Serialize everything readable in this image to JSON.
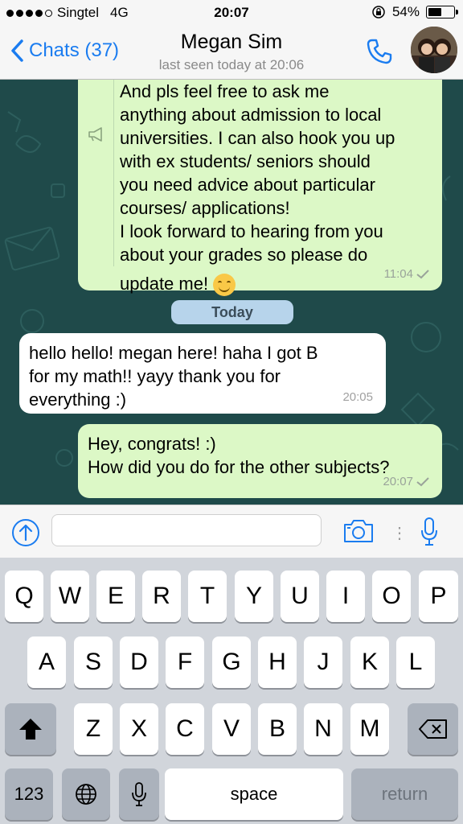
{
  "status_bar": {
    "carrier": "Singtel",
    "network": "4G",
    "time": "20:07",
    "battery_text": "54%",
    "battery_level": 0.54,
    "signal_bars": 4,
    "signal_total": 5
  },
  "nav": {
    "back_label": "Chats (37)",
    "contact_name": "Megan Sim",
    "last_seen": "last seen today at 20:06"
  },
  "messages": [
    {
      "direction": "out",
      "lines": [
        "And pls feel free to ask me",
        "anything about admission to local",
        "universities. I can also hook you up",
        "with ex students/ seniors should",
        "you need advice about particular",
        "courses/ applications!",
        "I look forward to hearing from you",
        "about your grades so please do",
        "update me!"
      ],
      "time": "11:04"
    },
    {
      "direction": "in",
      "lines": [
        "hello hello! megan here! haha I got B",
        "for my math!! yayy thank you for",
        "everything :)"
      ],
      "time": "20:05"
    },
    {
      "direction": "out",
      "lines": [
        "Hey, congrats! :)",
        "How did you do for the other subjects?"
      ],
      "time": "20:07"
    }
  ],
  "date_divider": "Today",
  "composer": {
    "value": ""
  },
  "keyboard": {
    "row1": [
      "Q",
      "W",
      "E",
      "R",
      "T",
      "Y",
      "U",
      "I",
      "O",
      "P"
    ],
    "row2": [
      "A",
      "S",
      "D",
      "F",
      "G",
      "H",
      "J",
      "K",
      "L"
    ],
    "row3": [
      "Z",
      "X",
      "C",
      "V",
      "B",
      "N",
      "M"
    ],
    "key_123": "123",
    "key_space": "space",
    "key_return": "return"
  },
  "colors": {
    "accent": "#1a7cf0",
    "outgoing_bubble": "#dcf8c6",
    "incoming_bubble": "#ffffff",
    "chat_background": "#1f4a4a",
    "date_chip": "#b7d4eb"
  },
  "icons": [
    "back-chevron-icon",
    "phone-icon",
    "megaphone-icon",
    "checkmark-icon",
    "smiley-emoji-icon",
    "upload-arrow-icon",
    "camera-icon",
    "microphone-icon",
    "shift-icon",
    "backspace-icon",
    "globe-icon",
    "keyboard-mic-icon"
  ]
}
